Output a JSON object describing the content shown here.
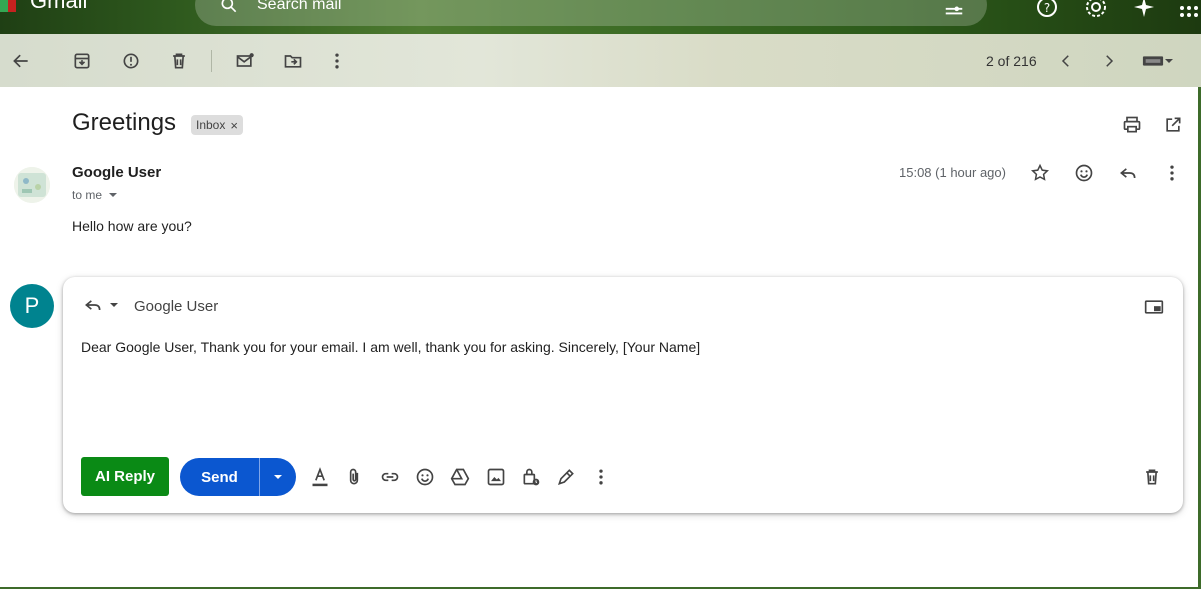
{
  "app": {
    "name": "Gmail"
  },
  "search": {
    "placeholder": "Search mail"
  },
  "toolbar": {
    "pager": "2 of 216"
  },
  "email": {
    "subject": "Greetings",
    "label": "Inbox",
    "sender": "Google User",
    "recipient_line": "to me",
    "timestamp": "15:08 (1 hour ago)",
    "body": "Hello how are you?"
  },
  "reply": {
    "avatar_letter": "P",
    "recipient": "Google User",
    "draft": "Dear Google User, Thank you for your email. I am well, thank you for asking. Sincerely, [Your Name]",
    "ai_reply_label": "AI Reply",
    "send_label": "Send"
  },
  "colors": {
    "ai_reply": "#0a8a15",
    "send": "#0b57d0",
    "avatar": "#00838f"
  }
}
